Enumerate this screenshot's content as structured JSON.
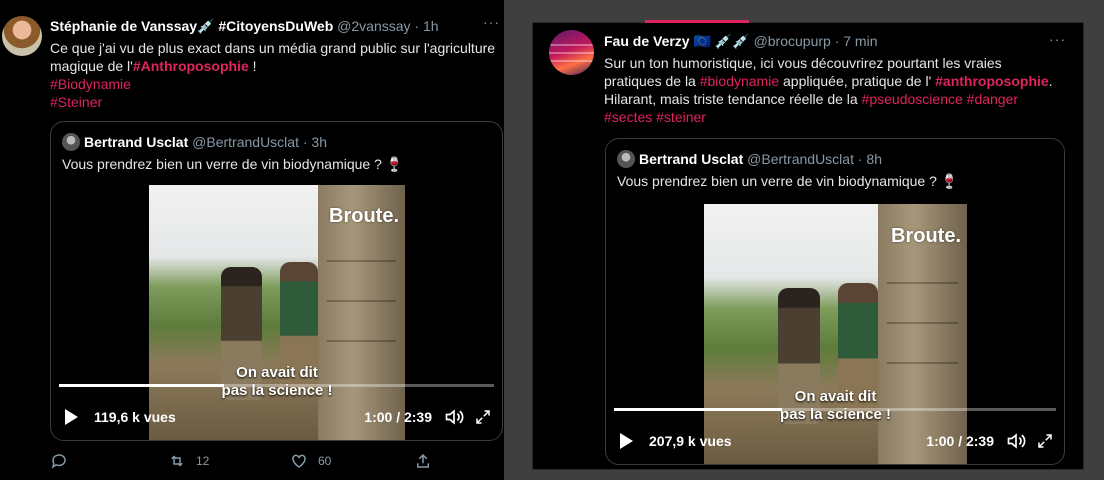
{
  "left_tweet": {
    "author_name": "Stéphanie de Vanssay",
    "name_suffix": "💉 #CitoyensDuWeb",
    "handle_time": "@2vanssay · 1h",
    "more": "···",
    "text_line1": "Ce que j'ai vu de plus exact dans un média grand public sur l'agriculture",
    "text_line2_pre": "magique de l'",
    "text_line2_tag": "#Anthroposophie",
    "text_line2_post": " !",
    "tag1": "#Biodynamie",
    "tag2": "#Steiner",
    "quote": {
      "author_name": "Bertrand Usclat",
      "handle_time": "@BertrandUsclat · 3h",
      "text": "Vous prendrez bien un verre de vin biodynamique ?",
      "emoji": "🍷",
      "video": {
        "brand": "Broute.",
        "subtitle_line1": "On avait dit",
        "subtitle_line2": "pas la science !",
        "views": "119,6 k vues",
        "time": "1:00 / 2:39",
        "progress": 0.38
      }
    },
    "actions": {
      "retweets": "12",
      "likes": "60"
    }
  },
  "right_tweet": {
    "author_name": "Fau de Verzy",
    "name_suffix": "🇪🇺 💉💉",
    "handle_time": "@brocupurp · 7 min",
    "more": "···",
    "line1": "Sur un ton humoristique, ici vous découvrirez pourtant les vraies",
    "line2_pre": "pratiques de la ",
    "line2_tag1": "#biodynamie",
    "line2_mid": " appliquée, pratique de l' ",
    "line2_tag2": "#anthroposophie",
    "line2_post": ".",
    "line3_pre": "Hilarant, mais triste tendance réelle de la ",
    "line3_tag1": "#pseudoscience",
    "line3_tag2": "#danger",
    "line4_tag1": "#sectes",
    "line4_tag2": "#steiner",
    "quote": {
      "author_name": "Bertrand Usclat",
      "handle_time": "@BertrandUsclat · 8h",
      "text": "Vous prendrez bien un verre de vin biodynamique ?",
      "emoji": "🍷",
      "video": {
        "brand": "Broute.",
        "subtitle_line1": "On avait dit",
        "subtitle_line2": "pas la science !",
        "views": "207,9 k vues",
        "time": "1:00 / 2:39",
        "progress": 0.38
      }
    }
  },
  "colors": {
    "hashtag": "#e0245e",
    "muted": "#8899a6",
    "background": "#000000",
    "frame": "#3f3f3f"
  }
}
